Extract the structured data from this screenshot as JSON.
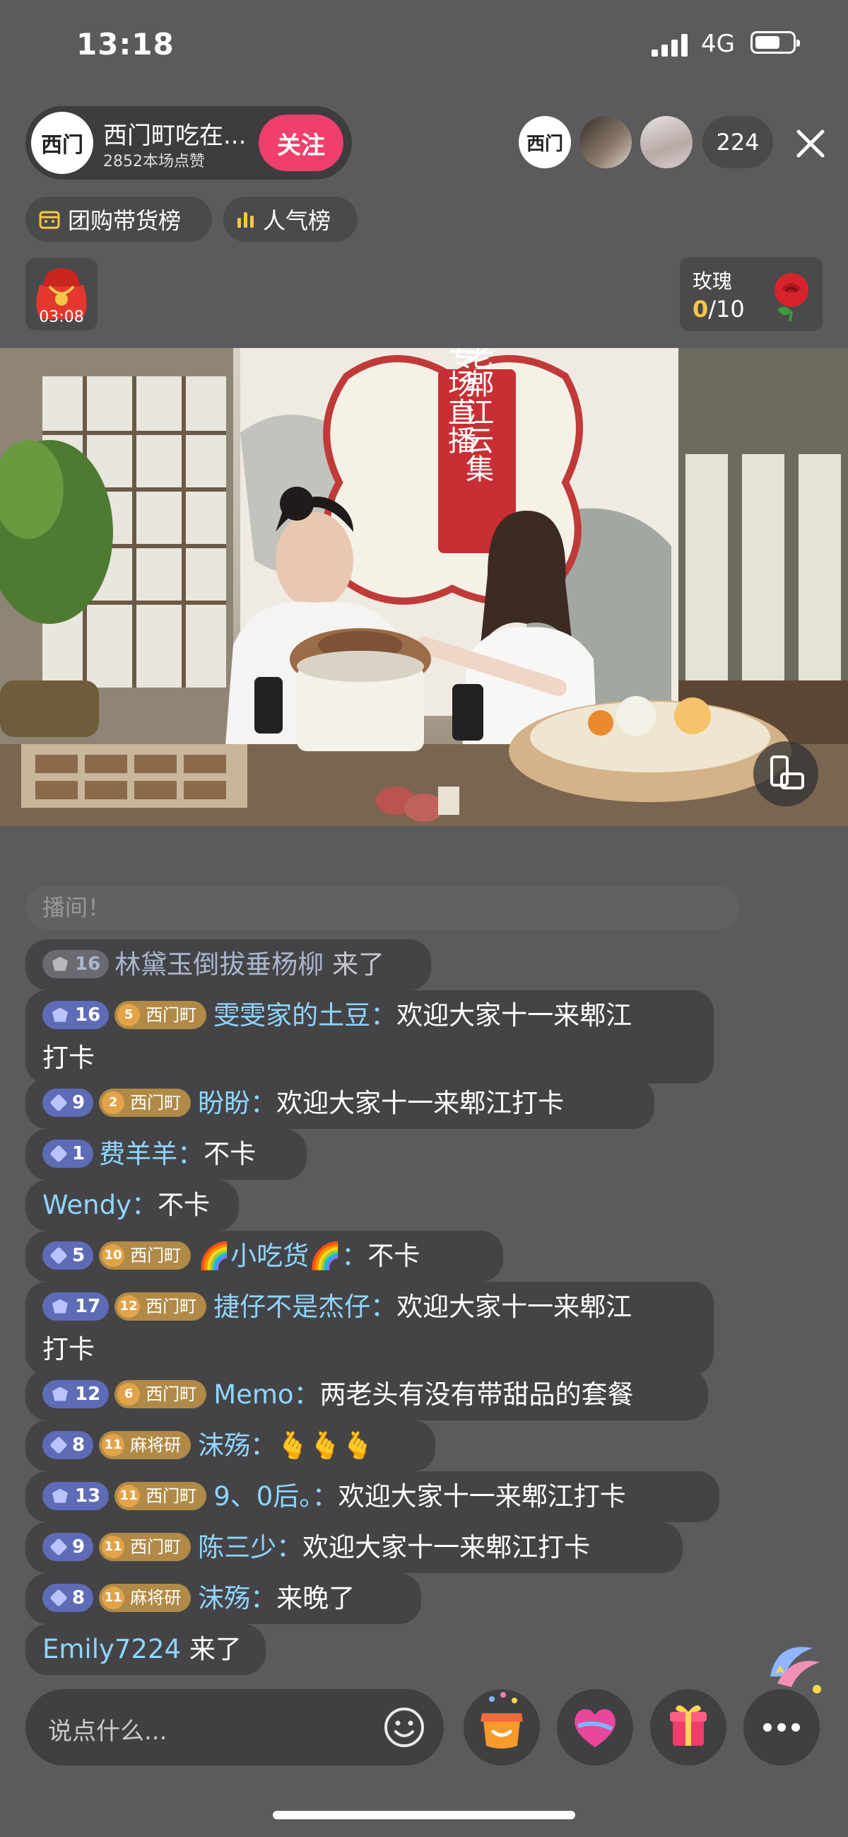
{
  "status": {
    "time": "13:18",
    "network": "4G"
  },
  "anchor": {
    "name": "西门町吃在...",
    "likes": "2852本场点赞",
    "follow_label": "关注",
    "avatar_text": "西门"
  },
  "viewers": {
    "count": "224"
  },
  "tags": {
    "group_buy": "团购带货榜",
    "popularity": "人气榜"
  },
  "red_packet": {
    "time": "03:08"
  },
  "rose": {
    "label": "玫瑰",
    "current": "0",
    "total": "/10"
  },
  "video": {
    "banner_title": "老郫江云集",
    "banner_sub": "专场直播"
  },
  "comments": {
    "faded": "播间！",
    "items": [
      {
        "level": "16",
        "user": "林黛玉倒拔垂杨柳",
        "action": "来了"
      },
      {
        "level": "16",
        "fan_level": "5",
        "fan_club": "西门町",
        "user": "雯雯家的土豆",
        "text_line1": "欢迎大家十一来郫江",
        "text_line2": "打卡"
      },
      {
        "level": "9",
        "fan_level": "2",
        "fan_club": "西门町",
        "user": "盼盼",
        "text": "欢迎大家十一来郫江打卡"
      },
      {
        "level": "1",
        "user": "费羊羊",
        "text": "不卡"
      },
      {
        "user": "Wendy",
        "text": "不卡"
      },
      {
        "level": "5",
        "fan_level": "10",
        "fan_club": "西门町",
        "user": "🌈小吃货🌈",
        "text": "不卡"
      },
      {
        "level": "17",
        "fan_level": "12",
        "fan_club": "西门町",
        "user": "捷仔不是杰仔",
        "text_line1": "欢迎大家十一来郫江",
        "text_line2": "打卡"
      },
      {
        "level": "12",
        "fan_level": "6",
        "fan_club": "西门町",
        "user": "Memo",
        "text": "两老头有没有带甜品的套餐"
      },
      {
        "level": "8",
        "fan_level": "11",
        "fan_club": "麻将研",
        "user": "沫殇",
        "text": "🫰🫰🫰"
      },
      {
        "level": "13",
        "fan_level": "11",
        "fan_club": "西门町",
        "user": "9、0后。",
        "text": "欢迎大家十一来郫江打卡"
      },
      {
        "level": "9",
        "fan_level": "11",
        "fan_club": "西门町",
        "user": "陈三少",
        "text": "欢迎大家十一来郫江打卡"
      },
      {
        "level": "8",
        "fan_level": "11",
        "fan_club": "麻将研",
        "user": "沫殇",
        "text": "来晚了"
      },
      {
        "user": "Emily7224",
        "action": "来了"
      }
    ]
  },
  "input": {
    "placeholder": "说点什么..."
  },
  "colors": {
    "follow": "#f03f6b",
    "username": "#8fd6ff",
    "level_badge": "#5e6bb6",
    "fan_badge": "#b08a46",
    "rose_count": "#f5c842"
  }
}
